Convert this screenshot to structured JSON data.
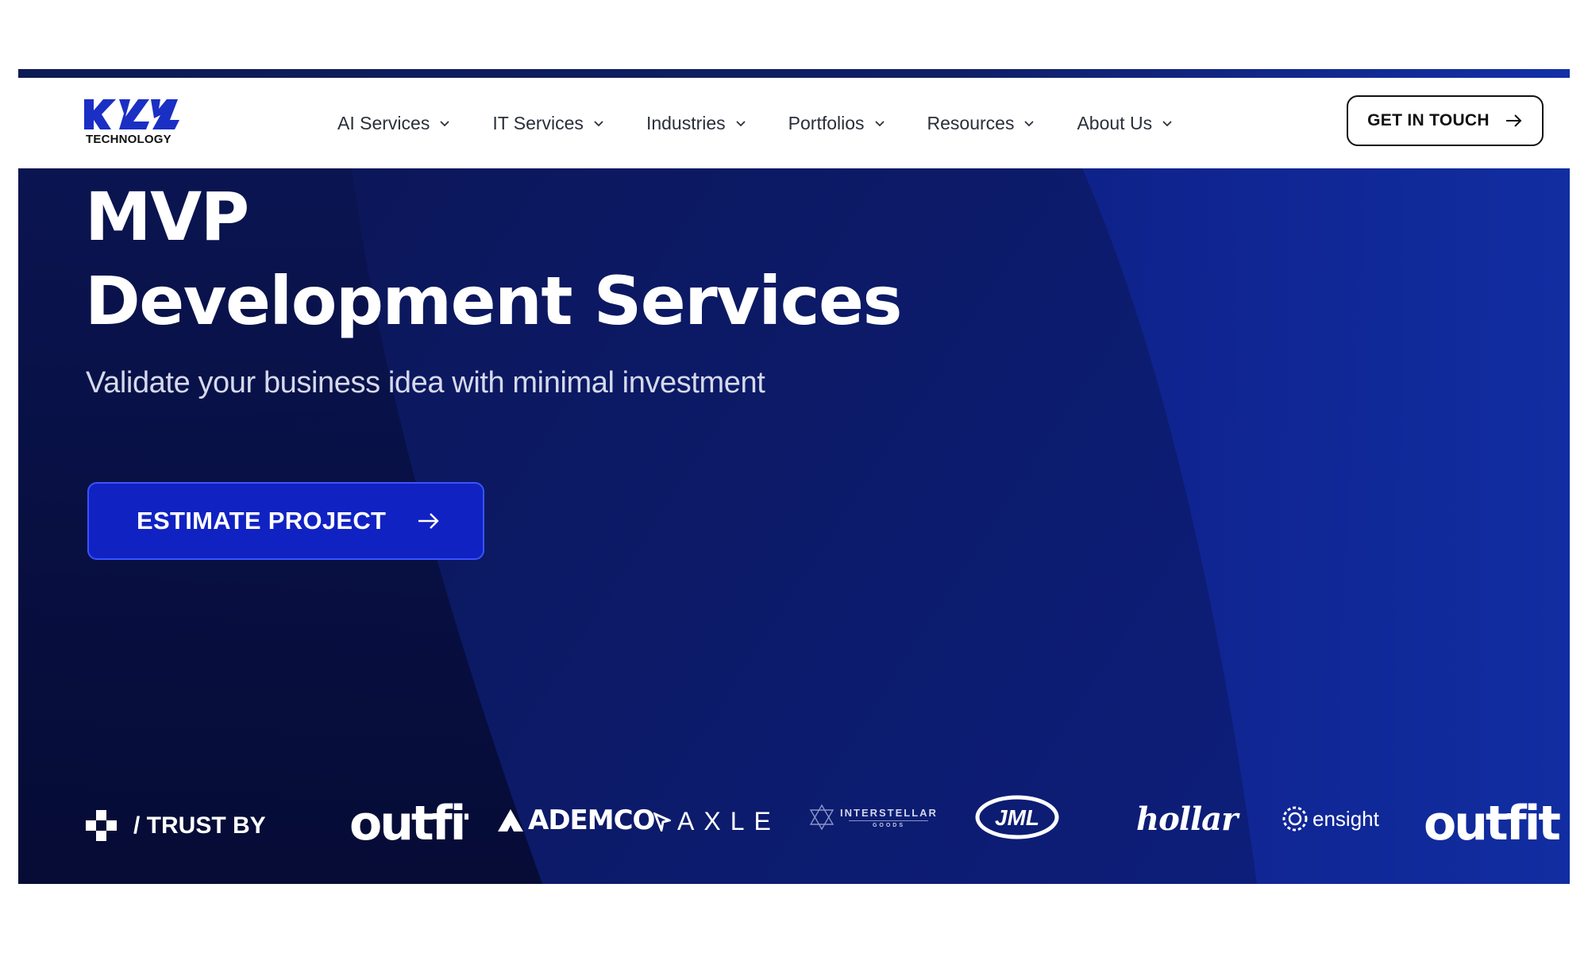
{
  "header": {
    "logo_text": "TECHNOLOGY",
    "nav_items": [
      {
        "label": "AI Services"
      },
      {
        "label": "IT Services"
      },
      {
        "label": "Industries"
      },
      {
        "label": "Portfolios"
      },
      {
        "label": "Resources"
      },
      {
        "label": "About Us"
      }
    ],
    "cta_label": "GET IN TOUCH"
  },
  "hero": {
    "title_line1": "MVP",
    "title_line2": "Development Services",
    "subtitle": "Validate your business idea with minimal investment",
    "cta_label": "ESTIMATE PROJECT"
  },
  "trust": {
    "label": "/ TRUST BY",
    "brands": [
      "outfit",
      "ADEMCO",
      "AXLE",
      "INTERSTELLAR",
      "GOODS",
      "JML",
      "hollar",
      "ensight",
      "outfit"
    ]
  },
  "colors": {
    "hero_bg": "#0b1a6e",
    "primary_button": "#1022c2",
    "logo_blue": "#1a2fc4"
  }
}
